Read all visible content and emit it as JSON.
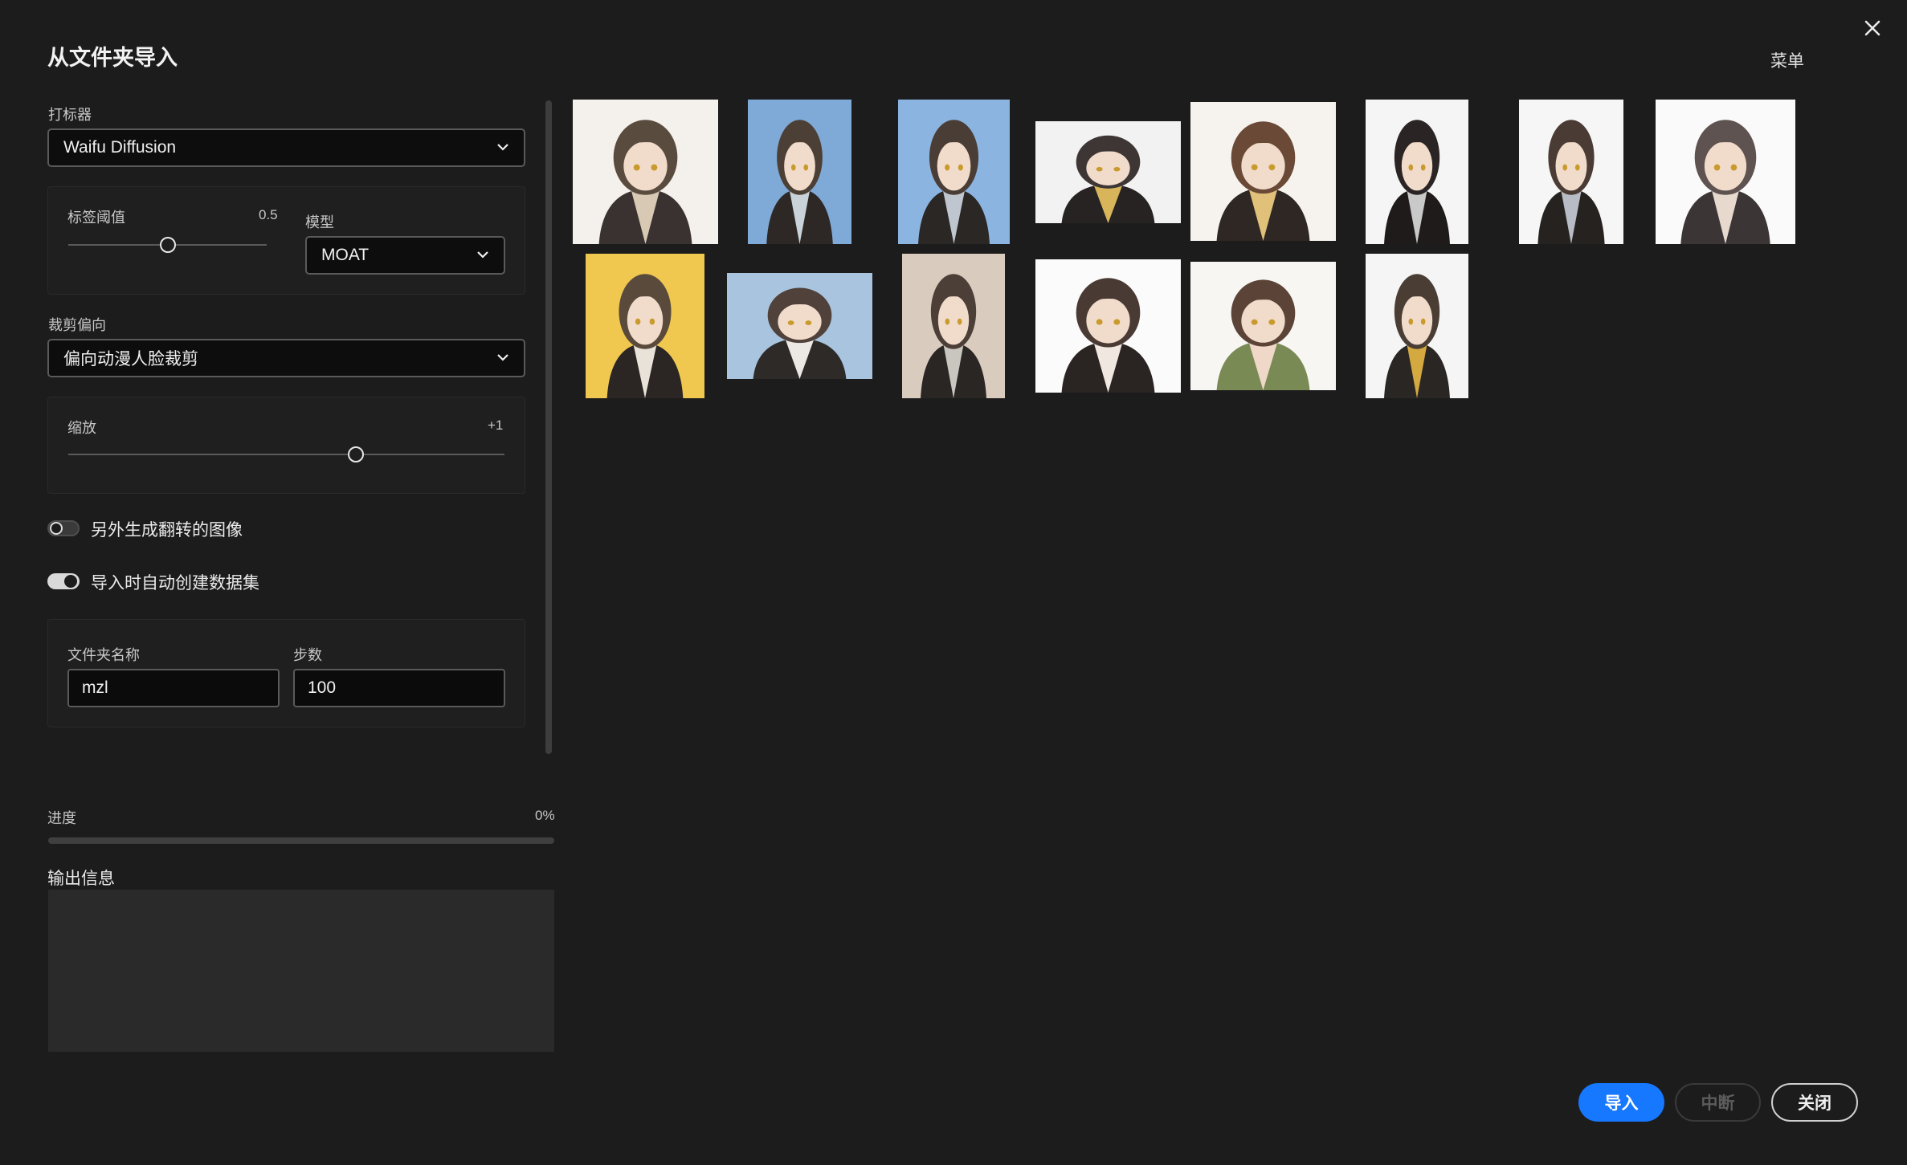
{
  "dialog": {
    "title": "从文件夹导入",
    "menu": "菜单"
  },
  "tagger": {
    "label": "打标器",
    "value": "Waifu Diffusion"
  },
  "threshold": {
    "label": "标签阈值",
    "value": "0.5",
    "fraction": 0.5
  },
  "model": {
    "label": "模型",
    "value": "MOAT"
  },
  "crop": {
    "label": "裁剪偏向",
    "value": "偏向动漫人脸裁剪"
  },
  "scale": {
    "label": "缩放",
    "value": "+1",
    "fraction": 0.66
  },
  "toggles": {
    "flip": {
      "label": "另外生成翻转的图像",
      "on": false
    },
    "auto_dataset": {
      "label": "导入时自动创建数据集",
      "on": true
    }
  },
  "folder": {
    "label": "文件夹名称",
    "value": "mzl"
  },
  "steps": {
    "label": "步数",
    "value": "100"
  },
  "progress": {
    "label": "进度",
    "value": "0%",
    "fraction": 0
  },
  "output": {
    "label": "输出信息",
    "content": ""
  },
  "buttons": {
    "import": "导入",
    "abort": "中断",
    "close": "关闭"
  },
  "colors": {
    "accent": "#1677ff",
    "background": "#1c1c1c",
    "panel": "#1f1f1f"
  },
  "gallery": {
    "count": 14,
    "thumbnail_icon": "anime-portrait-thumbnail"
  }
}
